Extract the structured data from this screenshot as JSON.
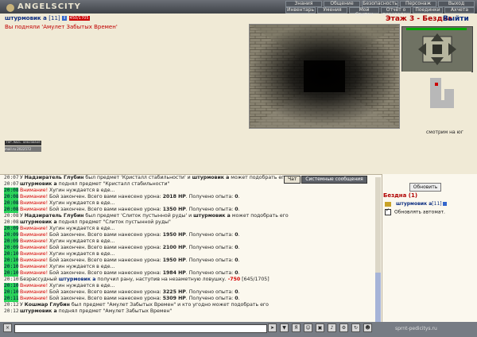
{
  "app": {
    "logo_text": "ANGELSCITY"
  },
  "menu": {
    "row1": [
      "Знания",
      "Общение",
      "Безопасность",
      "Персонаж",
      "Выход"
    ],
    "row2": [
      "Инвентарь",
      "Умения",
      "Мой Свиток",
      "Отчёт о переводах",
      "Поединки",
      "Ахчета"
    ]
  },
  "character": {
    "name": "штурмовик а",
    "level": "[11]",
    "hp": "450/1705"
  },
  "notice": "Вы подняли 'Амулет Забытых Времен'",
  "location": {
    "title": "Этаж 3 - Бездна",
    "exit_label": "Выйти"
  },
  "map": {
    "facing": "смотрим на юг"
  },
  "counters": {
    "c1": "TOP.MAIL 906236840",
    "c2": "mail.ru 2022572"
  },
  "tabs": [
    {
      "label": "Чат"
    },
    {
      "label": "Системные сообщения"
    }
  ],
  "right": {
    "refresh_label": "Обновить",
    "room_title": "Бездна (1)",
    "member_name": "штурмовик а",
    "member_level": "[11]",
    "auto_label": "Обновлять автомат."
  },
  "chat": [
    {
      "ts": "20:07",
      "hl": false,
      "segs": [
        {
          "t": "У "
        },
        {
          "t": "Надзиратель Глубин",
          "c": "b"
        },
        {
          "t": " был предмет 'Кристалл стабильности' и "
        },
        {
          "t": "штурмовик а",
          "c": "b"
        },
        {
          "t": " может подобрать его"
        }
      ]
    },
    {
      "ts": "20:07",
      "hl": false,
      "segs": [
        {
          "t": "штурмовик а",
          "c": "b"
        },
        {
          "t": " поднял предмет \"Кристалл стабильности\""
        }
      ]
    },
    {
      "ts": "20:08",
      "hl": true,
      "segs": [
        {
          "t": "Внимание!",
          "c": "warn"
        },
        {
          "t": " Хугин нуждается в еде..."
        }
      ]
    },
    {
      "ts": "20:08",
      "hl": true,
      "segs": [
        {
          "t": "Внимание!",
          "c": "warn"
        },
        {
          "t": " Бой закончен. Всего вами нанесено урона: "
        },
        {
          "t": "2018 HP",
          "c": "b"
        },
        {
          "t": ". Получено опыта: "
        },
        {
          "t": "0",
          "c": "b"
        },
        {
          "t": "."
        }
      ]
    },
    {
      "ts": "20:08",
      "hl": true,
      "segs": [
        {
          "t": "Внимание!",
          "c": "warn"
        },
        {
          "t": " Хугин нуждается в еде..."
        }
      ]
    },
    {
      "ts": "20:08",
      "hl": true,
      "segs": [
        {
          "t": "Внимание!",
          "c": "warn"
        },
        {
          "t": " Бой закончен. Всего вами нанесено урона: "
        },
        {
          "t": "1350 HP",
          "c": "b"
        },
        {
          "t": ". Получено опыта: "
        },
        {
          "t": "0",
          "c": "b"
        },
        {
          "t": "."
        }
      ]
    },
    {
      "ts": "20:08",
      "hl": false,
      "segs": [
        {
          "t": "У "
        },
        {
          "t": "Надзиратель Глубин",
          "c": "b"
        },
        {
          "t": " был предмет 'Слиток пустынной руды' и "
        },
        {
          "t": "штурмовик а",
          "c": "b"
        },
        {
          "t": " может подобрать его"
        }
      ]
    },
    {
      "ts": "20:08",
      "hl": false,
      "segs": [
        {
          "t": "штурмовик а",
          "c": "b"
        },
        {
          "t": " поднял предмет \"Слиток пустынной руды\""
        }
      ]
    },
    {
      "ts": "20:09",
      "hl": true,
      "segs": [
        {
          "t": "Внимание!",
          "c": "warn"
        },
        {
          "t": " Хугин нуждается в еде..."
        }
      ]
    },
    {
      "ts": "20:09",
      "hl": true,
      "segs": [
        {
          "t": "Внимание!",
          "c": "warn"
        },
        {
          "t": " Бой закончен. Всего вами нанесено урона: "
        },
        {
          "t": "1950 HP",
          "c": "b"
        },
        {
          "t": ". Получено опыта: "
        },
        {
          "t": "0",
          "c": "b"
        },
        {
          "t": "."
        }
      ]
    },
    {
      "ts": "20:09",
      "hl": true,
      "segs": [
        {
          "t": "Внимание!",
          "c": "warn"
        },
        {
          "t": " Хугин нуждается в еде..."
        }
      ]
    },
    {
      "ts": "20:09",
      "hl": true,
      "segs": [
        {
          "t": "Внимание!",
          "c": "warn"
        },
        {
          "t": " Бой закончен. Всего вами нанесено урона: "
        },
        {
          "t": "2100 HP",
          "c": "b"
        },
        {
          "t": ". Получено опыта: "
        },
        {
          "t": "0",
          "c": "b"
        },
        {
          "t": "."
        }
      ]
    },
    {
      "ts": "20:10",
      "hl": true,
      "segs": [
        {
          "t": "Внимание!",
          "c": "warn"
        },
        {
          "t": " Хугин нуждается в еде..."
        }
      ]
    },
    {
      "ts": "20:10",
      "hl": true,
      "segs": [
        {
          "t": "Внимание!",
          "c": "warn"
        },
        {
          "t": " Бой закончен. Всего вами нанесено урона: "
        },
        {
          "t": "1950 HP",
          "c": "b"
        },
        {
          "t": ". Получено опыта: "
        },
        {
          "t": "0",
          "c": "b"
        },
        {
          "t": "."
        }
      ]
    },
    {
      "ts": "20:10",
      "hl": true,
      "segs": [
        {
          "t": "Внимание!",
          "c": "warn"
        },
        {
          "t": " Хугин нуждается в еде..."
        }
      ]
    },
    {
      "ts": "20:10",
      "hl": true,
      "segs": [
        {
          "t": "Внимание!",
          "c": "warn"
        },
        {
          "t": " Бой закончен. Всего вами нанесено урона: "
        },
        {
          "t": "1984 HP",
          "c": "b"
        },
        {
          "t": ". Получено опыта: "
        },
        {
          "t": "0",
          "c": "b"
        },
        {
          "t": "."
        }
      ]
    },
    {
      "ts": "20:10",
      "hl": false,
      "segs": [
        {
          "t": "Безрассудный "
        },
        {
          "t": "штурмовик а",
          "c": "n"
        },
        {
          "t": " получил рану, наступив на незаметную ловушку. "
        },
        {
          "t": "-750",
          "c": "neg"
        },
        {
          "t": " [645/1705]"
        }
      ]
    },
    {
      "ts": "20:10",
      "hl": true,
      "segs": [
        {
          "t": "Внимание!",
          "c": "warn"
        },
        {
          "t": " Хугин нуждается в еде..."
        }
      ]
    },
    {
      "ts": "20:10",
      "hl": true,
      "segs": [
        {
          "t": "Внимание!",
          "c": "warn"
        },
        {
          "t": " Бой закончен. Всего вами нанесено урона: "
        },
        {
          "t": "3225 HP",
          "c": "b"
        },
        {
          "t": ". Получено опыта: "
        },
        {
          "t": "0",
          "c": "b"
        },
        {
          "t": "."
        }
      ]
    },
    {
      "ts": "20:11",
      "hl": true,
      "segs": [
        {
          "t": "Внимание!",
          "c": "warn"
        },
        {
          "t": " Бой закончен. Всего вами нанесено урона: "
        },
        {
          "t": "5309 HP",
          "c": "b"
        },
        {
          "t": ". Получено опыта: "
        },
        {
          "t": "0",
          "c": "b"
        },
        {
          "t": "."
        }
      ]
    },
    {
      "ts": "20:12",
      "hl": false,
      "segs": [
        {
          "t": "У "
        },
        {
          "t": "Кошмар Глубин",
          "c": "b"
        },
        {
          "t": " был предмет \"Амулет Забытых Времен\" и кто угодно может подобрать его"
        }
      ]
    },
    {
      "ts": "20:12",
      "hl": false,
      "segs": [
        {
          "t": "штурмовик а",
          "c": "b"
        },
        {
          "t": " поднял предмет \"Амулет Забытых Времен\""
        }
      ]
    }
  ],
  "watermark": "sprnt-pedicitys.ru"
}
